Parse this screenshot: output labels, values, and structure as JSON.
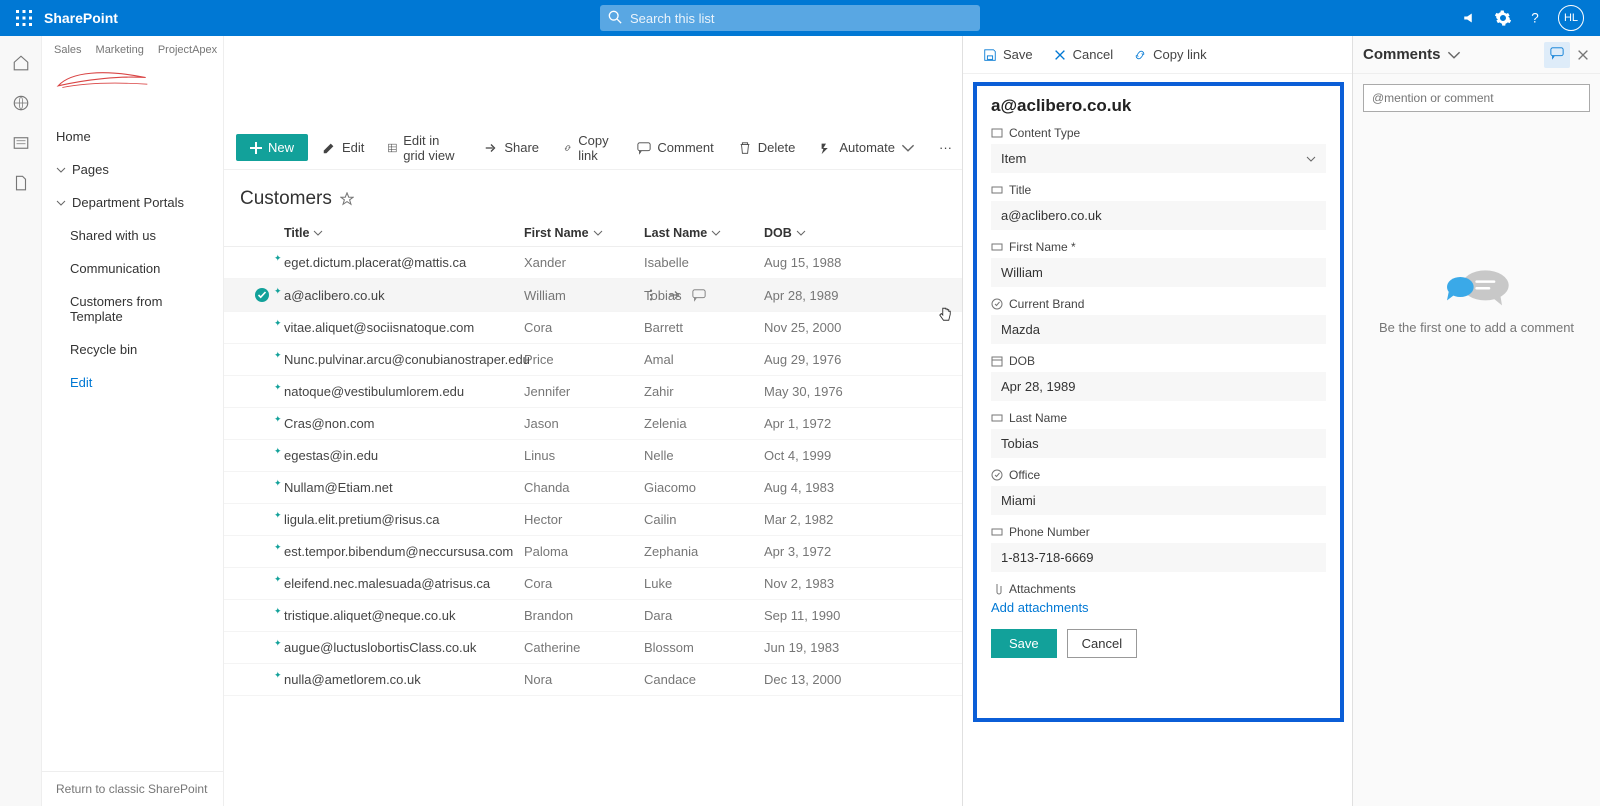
{
  "header": {
    "app_name": "SharePoint",
    "search_placeholder": "Search this list",
    "avatar_initials": "HL"
  },
  "site": {
    "tabs": [
      "Sales",
      "Marketing",
      "ProjectApex"
    ]
  },
  "leftnav": {
    "home": "Home",
    "pages": "Pages",
    "dept": "Department Portals",
    "shared": "Shared with us",
    "comm": "Communication",
    "cust_tpl": "Customers from Template",
    "recycle": "Recycle bin",
    "edit": "Edit",
    "return": "Return to classic SharePoint"
  },
  "commands": {
    "new": "New",
    "edit": "Edit",
    "edit_grid": "Edit in grid view",
    "share": "Share",
    "copy_link": "Copy link",
    "comment": "Comment",
    "delete": "Delete",
    "automate": "Automate"
  },
  "list": {
    "title": "Customers",
    "cols": {
      "title": "Title",
      "first": "First Name",
      "last": "Last Name",
      "dob": "DOB"
    },
    "rows": [
      {
        "title": "eget.dictum.placerat@mattis.ca",
        "first": "Xander",
        "last": "Isabelle",
        "dob": "Aug 15, 1988"
      },
      {
        "title": "a@aclibero.co.uk",
        "first": "William",
        "last": "Tobias",
        "dob": "Apr 28, 1989",
        "selected": true
      },
      {
        "title": "vitae.aliquet@sociisnatoque.com",
        "first": "Cora",
        "last": "Barrett",
        "dob": "Nov 25, 2000"
      },
      {
        "title": "Nunc.pulvinar.arcu@conubianostraper.edu",
        "first": "Price",
        "last": "Amal",
        "dob": "Aug 29, 1976"
      },
      {
        "title": "natoque@vestibulumlorem.edu",
        "first": "Jennifer",
        "last": "Zahir",
        "dob": "May 30, 1976"
      },
      {
        "title": "Cras@non.com",
        "first": "Jason",
        "last": "Zelenia",
        "dob": "Apr 1, 1972"
      },
      {
        "title": "egestas@in.edu",
        "first": "Linus",
        "last": "Nelle",
        "dob": "Oct 4, 1999"
      },
      {
        "title": "Nullam@Etiam.net",
        "first": "Chanda",
        "last": "Giacomo",
        "dob": "Aug 4, 1983"
      },
      {
        "title": "ligula.elit.pretium@risus.ca",
        "first": "Hector",
        "last": "Cailin",
        "dob": "Mar 2, 1982"
      },
      {
        "title": "est.tempor.bibendum@neccursusa.com",
        "first": "Paloma",
        "last": "Zephania",
        "dob": "Apr 3, 1972"
      },
      {
        "title": "eleifend.nec.malesuada@atrisus.ca",
        "first": "Cora",
        "last": "Luke",
        "dob": "Nov 2, 1983"
      },
      {
        "title": "tristique.aliquet@neque.co.uk",
        "first": "Brandon",
        "last": "Dara",
        "dob": "Sep 11, 1990"
      },
      {
        "title": "augue@luctuslobortisClass.co.uk",
        "first": "Catherine",
        "last": "Blossom",
        "dob": "Jun 19, 1983"
      },
      {
        "title": "nulla@ametlorem.co.uk",
        "first": "Nora",
        "last": "Candace",
        "dob": "Dec 13, 2000"
      }
    ]
  },
  "panel_cmd": {
    "save": "Save",
    "cancel": "Cancel",
    "copy_link": "Copy link"
  },
  "form": {
    "heading": "a@aclibero.co.uk",
    "labels": {
      "content_type": "Content Type",
      "title": "Title",
      "first": "First Name *",
      "brand": "Current Brand",
      "dob": "DOB",
      "last": "Last Name",
      "office": "Office",
      "phone": "Phone Number",
      "attach": "Attachments"
    },
    "values": {
      "content_type": "Item",
      "title": "a@aclibero.co.uk",
      "first": "William",
      "brand": "Mazda",
      "dob": "Apr 28, 1989",
      "last": "Tobias",
      "office": "Miami",
      "phone": "1-813-718-6669"
    },
    "add_attach": "Add attachments",
    "save": "Save",
    "cancel": "Cancel"
  },
  "comments": {
    "title": "Comments",
    "placeholder": "@mention or comment",
    "empty": "Be the first one to add a comment"
  }
}
